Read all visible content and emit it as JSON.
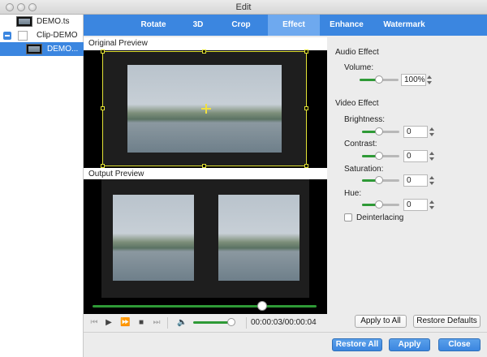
{
  "window": {
    "title": "Edit"
  },
  "sidebar": {
    "items": [
      {
        "label": "DEMO.ts"
      },
      {
        "label": "Clip-DEMO"
      },
      {
        "label": "DEMO..."
      }
    ]
  },
  "tabs": [
    {
      "label": "Rotate"
    },
    {
      "label": "3D"
    },
    {
      "label": "Crop"
    },
    {
      "label": "Effect",
      "active": true
    },
    {
      "label": "Enhance"
    },
    {
      "label": "Watermark"
    }
  ],
  "preview": {
    "original_label": "Original Preview",
    "output_label": "Output Preview"
  },
  "player": {
    "timecode": "00:00:03/00:00:04",
    "seek_fraction": 0.75,
    "volume_fraction": 0.9
  },
  "audio": {
    "section_title": "Audio Effect",
    "volume_label": "Volume:",
    "volume_value": "100%"
  },
  "video": {
    "section_title": "Video Effect",
    "brightness_label": "Brightness:",
    "brightness_value": "0",
    "contrast_label": "Contrast:",
    "contrast_value": "0",
    "saturation_label": "Saturation:",
    "saturation_value": "0",
    "hue_label": "Hue:",
    "hue_value": "0",
    "deinterlacing_label": "Deinterlacing"
  },
  "buttons": {
    "apply_to_all": "Apply to All",
    "restore_defaults": "Restore Defaults",
    "restore_all": "Restore All",
    "apply": "Apply",
    "close": "Close"
  },
  "colors": {
    "accent": "#3b86e0",
    "active_tab": "#6ea9ef",
    "slider_fill": "#2e9a36",
    "crop_box": "#e3e336"
  }
}
